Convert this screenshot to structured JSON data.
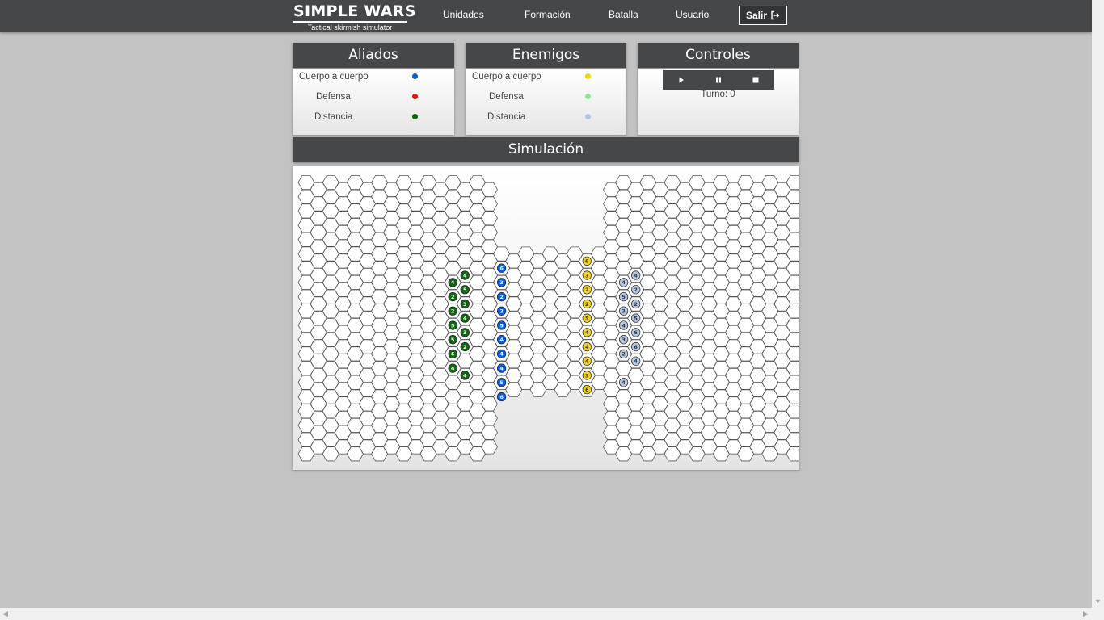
{
  "brand": {
    "title": "SIMPLE WARS",
    "subtitle": "Tactical skirmish simulator"
  },
  "nav": {
    "links": [
      "Unidades",
      "Formación",
      "Batalla",
      "Usuario"
    ],
    "logout_label": "Salir",
    "logout_icon": "sign-out-icon"
  },
  "allies": {
    "title": "Aliados",
    "items": [
      {
        "label": "Cuerpo a cuerpo",
        "color": "#0a5be0"
      },
      {
        "label": "Defensa",
        "color": "#e8140c"
      },
      {
        "label": "Distancia",
        "color": "#0b6a0b"
      }
    ]
  },
  "enemies": {
    "title": "Enemigos",
    "items": [
      {
        "label": "Cuerpo a cuerpo",
        "color": "#f3d410"
      },
      {
        "label": "Defensa",
        "color": "#8de88d"
      },
      {
        "label": "Distancia",
        "color": "#b3c6e3"
      }
    ]
  },
  "controls": {
    "title": "Controles",
    "buttons": [
      "play-icon",
      "pause-icon",
      "stop-icon"
    ],
    "turn_label": "Turno: 0"
  },
  "simulation": {
    "title": "Simulación",
    "units": {
      "ally_ranged": [
        {
          "col": 13,
          "row": 6,
          "n": "4"
        },
        {
          "col": 12,
          "row": 7,
          "n": "4"
        },
        {
          "col": 13,
          "row": 7,
          "n": "5"
        },
        {
          "col": 12,
          "row": 8,
          "n": "2"
        },
        {
          "col": 13,
          "row": 8,
          "n": "3"
        },
        {
          "col": 12,
          "row": 9,
          "n": "2"
        },
        {
          "col": 13,
          "row": 9,
          "n": "4"
        },
        {
          "col": 12,
          "row": 10,
          "n": "5"
        },
        {
          "col": 13,
          "row": 10,
          "n": "3"
        },
        {
          "col": 12,
          "row": 11,
          "n": "5"
        },
        {
          "col": 13,
          "row": 11,
          "n": "2"
        },
        {
          "col": 12,
          "row": 12,
          "n": "6"
        },
        {
          "col": 12,
          "row": 13,
          "n": "4"
        },
        {
          "col": 13,
          "row": 13,
          "n": "4"
        }
      ],
      "ally_melee": [
        {
          "col": 16,
          "row": 6,
          "n": "6"
        },
        {
          "col": 16,
          "row": 7,
          "n": "3"
        },
        {
          "col": 16,
          "row": 8,
          "n": "2"
        },
        {
          "col": 16,
          "row": 9,
          "n": "2"
        },
        {
          "col": 16,
          "row": 10,
          "n": "5"
        },
        {
          "col": 16,
          "row": 11,
          "n": "4"
        },
        {
          "col": 16,
          "row": 12,
          "n": "4"
        },
        {
          "col": 16,
          "row": 13,
          "n": "4"
        },
        {
          "col": 16,
          "row": 14,
          "n": "5"
        },
        {
          "col": 16,
          "row": 15,
          "n": "6"
        }
      ],
      "enemy_melee": [
        {
          "col": 23,
          "row": 5,
          "n": "6"
        },
        {
          "col": 23,
          "row": 6,
          "n": "3"
        },
        {
          "col": 23,
          "row": 7,
          "n": "2"
        },
        {
          "col": 23,
          "row": 8,
          "n": "2"
        },
        {
          "col": 23,
          "row": 9,
          "n": "5"
        },
        {
          "col": 23,
          "row": 10,
          "n": "4"
        },
        {
          "col": 23,
          "row": 11,
          "n": "4"
        },
        {
          "col": 23,
          "row": 12,
          "n": "4"
        },
        {
          "col": 23,
          "row": 13,
          "n": "3"
        },
        {
          "col": 23,
          "row": 14,
          "n": "6"
        }
      ],
      "enemy_ranged": [
        {
          "col": 27,
          "row": 6,
          "n": "4"
        },
        {
          "col": 26,
          "row": 7,
          "n": "4"
        },
        {
          "col": 27,
          "row": 7,
          "n": "2"
        },
        {
          "col": 26,
          "row": 8,
          "n": "5"
        },
        {
          "col": 27,
          "row": 8,
          "n": "2"
        },
        {
          "col": 26,
          "row": 9,
          "n": "3"
        },
        {
          "col": 27,
          "row": 9,
          "n": "5"
        },
        {
          "col": 26,
          "row": 10,
          "n": "4"
        },
        {
          "col": 27,
          "row": 10,
          "n": "6"
        },
        {
          "col": 26,
          "row": 11,
          "n": "3"
        },
        {
          "col": 27,
          "row": 11,
          "n": "6"
        },
        {
          "col": 26,
          "row": 12,
          "n": "2"
        },
        {
          "col": 27,
          "row": 12,
          "n": "4"
        },
        {
          "col": 26,
          "row": 14,
          "n": "4"
        }
      ]
    }
  }
}
